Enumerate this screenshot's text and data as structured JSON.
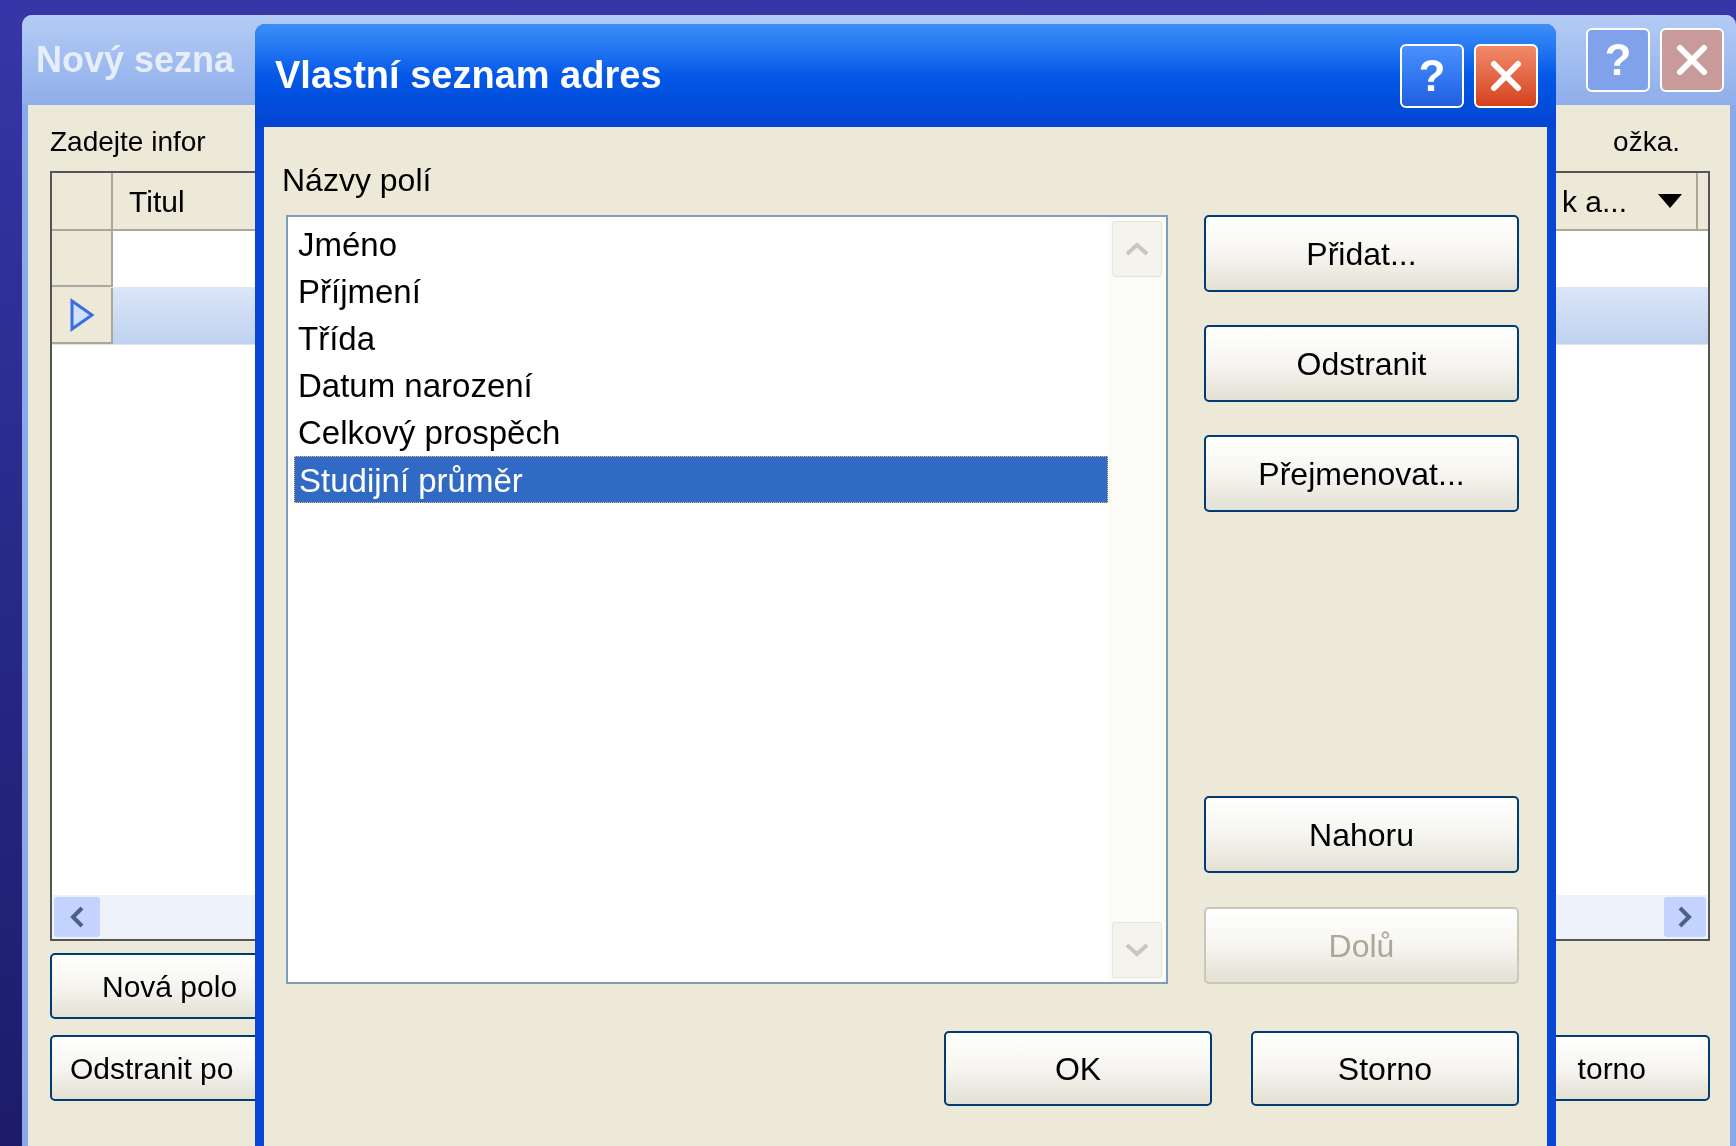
{
  "background_window": {
    "title": "Nový sezna",
    "help_button": "?",
    "instruction_start": "Zadejte infor",
    "instruction_end": "ožka.",
    "table": {
      "columns": [
        "Titul",
        "k a..."
      ],
      "rows": [
        {
          "selected": false
        },
        {
          "selected": true
        }
      ]
    },
    "left_buttons": [
      "Nová polo",
      "Odstranit po"
    ],
    "right_button": "torno"
  },
  "dialog": {
    "title": "Vlastní seznam adres",
    "help_button": "?",
    "list_label": "Názvy polí",
    "fields": [
      {
        "label": "Jméno",
        "selected": false
      },
      {
        "label": "Příjmení",
        "selected": false
      },
      {
        "label": "Třída",
        "selected": false
      },
      {
        "label": "Datum narození",
        "selected": false
      },
      {
        "label": "Celkový prospěch",
        "selected": false
      },
      {
        "label": "Studijní průměr",
        "selected": true
      }
    ],
    "top_buttons": [
      {
        "label": "Přidat...",
        "disabled": false
      },
      {
        "label": "Odstranit",
        "disabled": false
      },
      {
        "label": "Přejmenovat...",
        "disabled": false
      }
    ],
    "bottom_buttons": [
      {
        "label": "Nahoru",
        "disabled": false
      },
      {
        "label": "Dolů",
        "disabled": true
      }
    ],
    "ok": "OK",
    "cancel": "Storno"
  }
}
